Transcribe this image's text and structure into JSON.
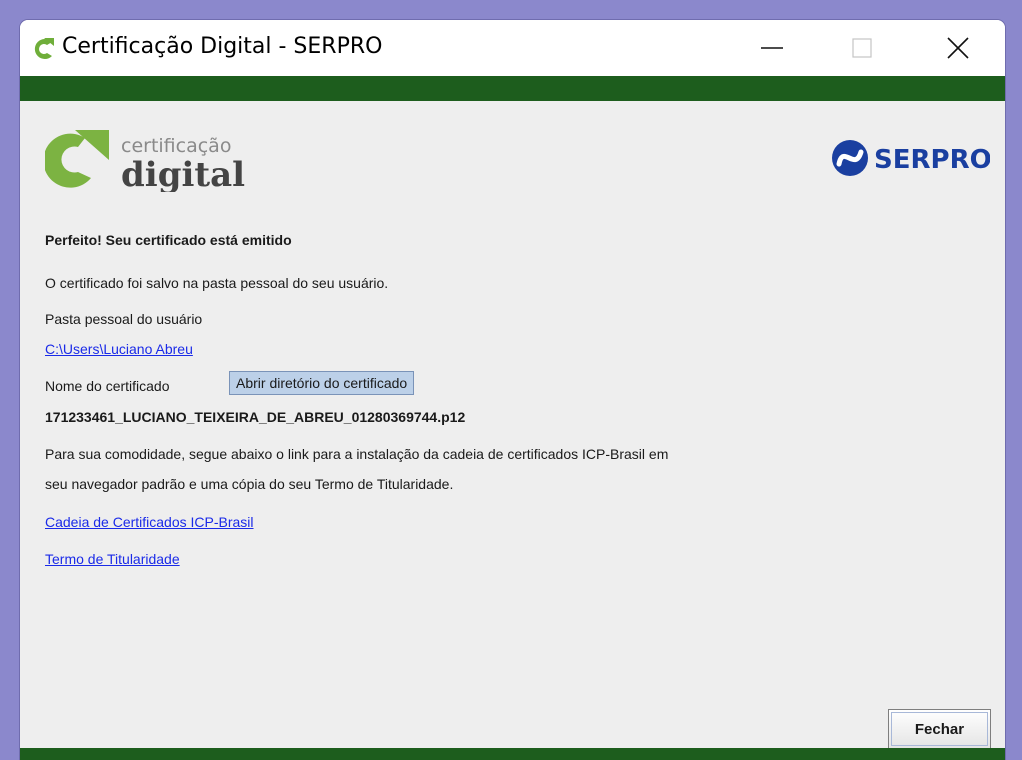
{
  "window": {
    "title": "Certificação Digital - SERPRO"
  },
  "logos": {
    "cert_small": "certificação",
    "cert_big": "digital",
    "serpro": "SERPRO"
  },
  "content": {
    "heading": "Perfeito! Seu certificado está emitido",
    "saved_message": "O certificado foi salvo na pasta pessoal do seu usuário.",
    "user_folder_label": "Pasta pessoal do usuário",
    "user_folder_path": "C:\\Users\\Luciano Abreu",
    "cert_name_label": "Nome do certificado",
    "open_dir_button": "Abrir diretório do certificado",
    "cert_filename": "171233461_LUCIANO_TEIXEIRA_DE_ABREU_01280369744.p12",
    "info_line1": "Para sua comodidade, segue abaixo o link para a instalação da cadeia de certificados ICP-Brasil em",
    "info_line2": "seu navegador padrão e uma cópia do seu Termo de Titularidade.",
    "link_chain": "Cadeia de Certificados ICP-Brasil",
    "link_term": "Termo de Titularidade",
    "close_button": "Fechar"
  },
  "colors": {
    "brand_green": "#1d5d1d",
    "logo_green": "#7cb342",
    "serpro_blue": "#1a3fa0",
    "link_blue": "#1a2ae8"
  }
}
